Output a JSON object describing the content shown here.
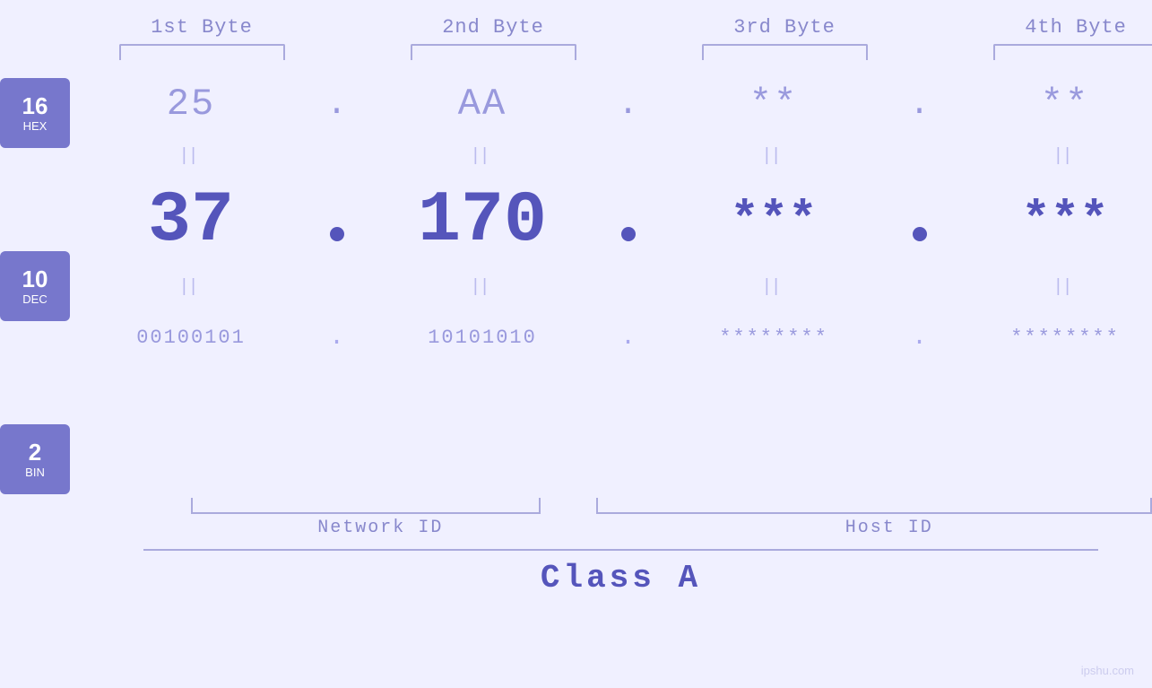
{
  "headers": {
    "byte1": "1st Byte",
    "byte2": "2nd Byte",
    "byte3": "3rd Byte",
    "byte4": "4th Byte"
  },
  "badges": {
    "hex": {
      "num": "16",
      "label": "HEX"
    },
    "dec": {
      "num": "10",
      "label": "DEC"
    },
    "bin": {
      "num": "2",
      "label": "BIN"
    }
  },
  "bytes": {
    "b1": {
      "hex": "25",
      "dec": "37",
      "bin": "00100101"
    },
    "b2": {
      "hex": "AA",
      "dec": "170",
      "bin": "10101010"
    },
    "b3": {
      "hex": "**",
      "dec": "***",
      "bin": "********"
    },
    "b4": {
      "hex": "**",
      "dec": "***",
      "bin": "********"
    }
  },
  "labels": {
    "network_id": "Network ID",
    "host_id": "Host ID",
    "class": "Class A"
  },
  "watermark": "ipshu.com"
}
